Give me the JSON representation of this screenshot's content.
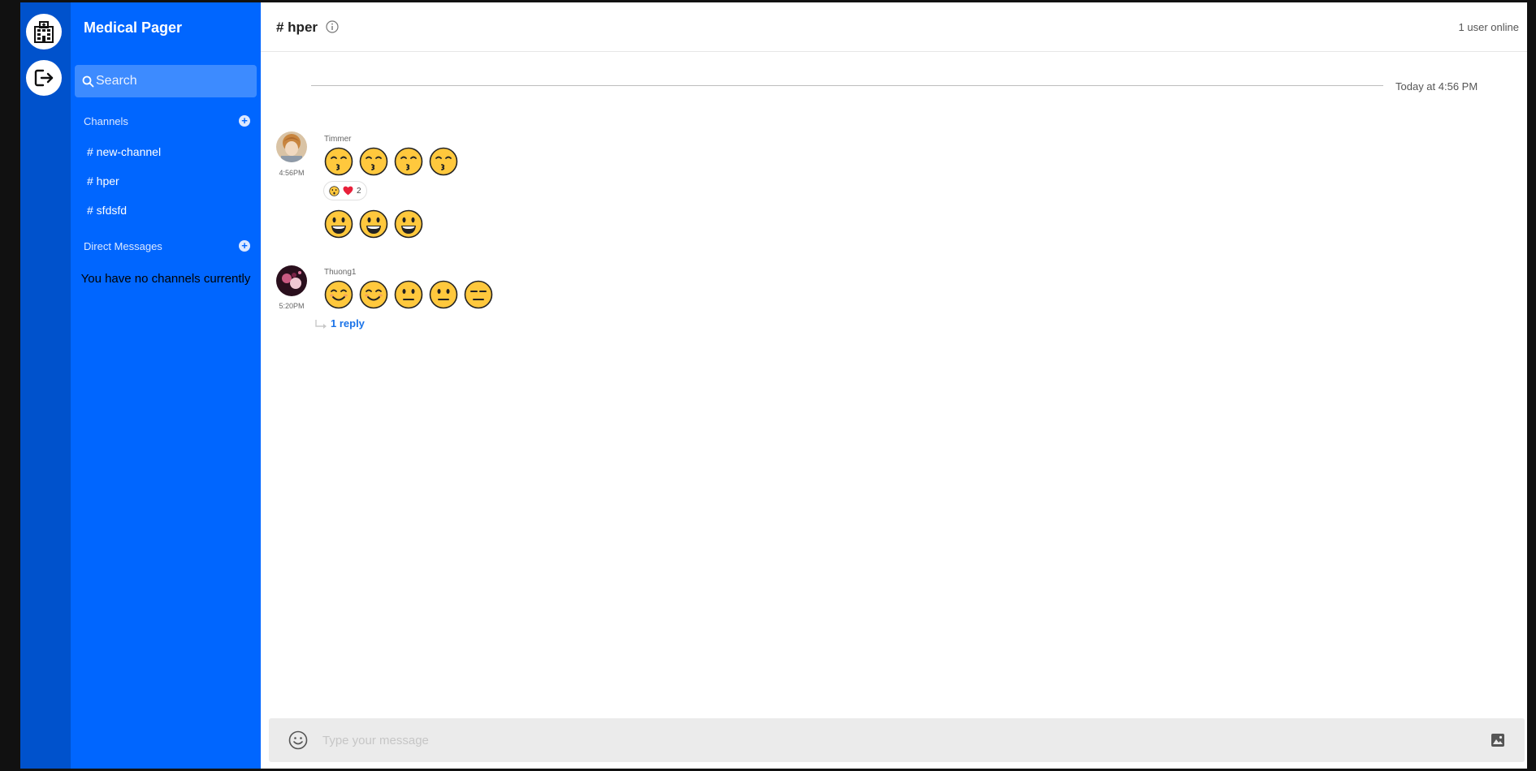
{
  "app": {
    "name": "Medical Pager",
    "rail_icons": [
      "hospital-icon",
      "logout-icon"
    ]
  },
  "sidebar": {
    "search_placeholder": "Search",
    "channels_header": "Channels",
    "channels": [
      {
        "label": "# new-channel"
      },
      {
        "label": "# hper"
      },
      {
        "label": "# sfdsfd"
      }
    ],
    "dm_header": "Direct Messages",
    "empty_text": "You have no channels currently"
  },
  "header": {
    "title": "# hper",
    "online": "1 user online"
  },
  "day_label": "Today at 4:56 PM",
  "messages": [
    {
      "author": "Timmer",
      "time": "4:56PM",
      "emoji_rows": [
        [
          "face-blowing-kiss-icon",
          "face-blowing-kiss-icon",
          "face-blowing-kiss-icon",
          "face-blowing-kiss-icon"
        ],
        [
          "grinning-face-icon",
          "grinning-face-icon",
          "grinning-face-icon"
        ]
      ],
      "reaction": {
        "icons": [
          "hushed-face-icon",
          "red-heart-icon"
        ],
        "count": "2"
      }
    },
    {
      "author": "Thuong1",
      "time": "5:20PM",
      "emoji_rows": [
        [
          "smiling-face-icon",
          "smiling-face-icon",
          "neutral-face-icon",
          "neutral-face-icon",
          "expressionless-face-icon"
        ]
      ],
      "reply": "1 reply"
    }
  ],
  "composer": {
    "placeholder": "Type your message"
  },
  "colors": {
    "rail": "#0052cc",
    "sidebar": "#0066ff",
    "search": "#3d8bff",
    "link": "#1a73e8",
    "emoji_fill": "#ffc83d"
  }
}
